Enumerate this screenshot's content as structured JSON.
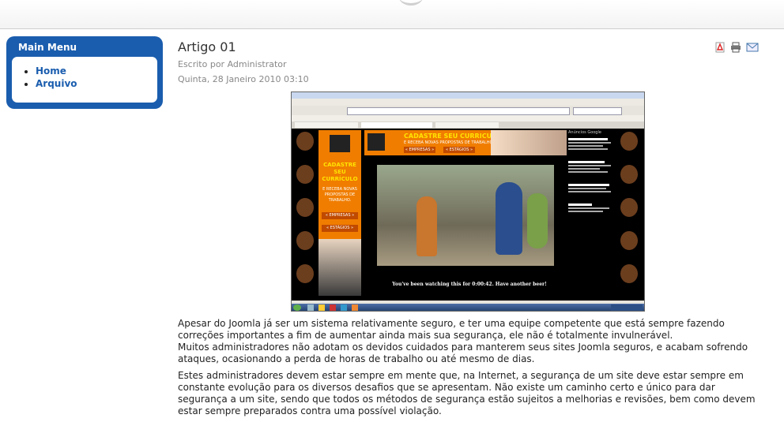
{
  "sidebar": {
    "title": "Main Menu",
    "items": [
      {
        "label": "Home"
      },
      {
        "label": "Arquivo"
      }
    ]
  },
  "article": {
    "title": "Artigo 01",
    "author": "Escrito por Administrator",
    "date": "Quinta, 28 Janeiro 2010 03:10",
    "paragraph1_line1": "Apesar do Joomla já ser um sistema relativamente seguro, e ter uma equipe competente que está sempre fazendo correções importantes a fim de aumentar ainda mais sua segurança, ele não é totalmente invulnerável.",
    "paragraph1_line2": "Muitos administradores não adotam os devidos cuidados para manterem seus sites Joomla seguros, e acabam sofrendo ataques, ocasionando a perda de horas de trabalho ou até mesmo de dias.",
    "paragraph2": "Estes administradores devem estar sempre em mente que, na Internet, a segurança de um site deve estar sempre em constante evolução para os diversos desafios que se apresentam. Não existe um caminho certo e único para dar segurança a um site, sendo que todos os métodos de segurança estão sujeitos a melhorias e revisões, bem como devem estar sempre preparados contra uma possível violação."
  },
  "screenshot": {
    "banner_main": "CADASTRE SEU CURRICULO",
    "banner_sub": "E RECEBA NOVAS PROPOSTAS DE TRABALHO.",
    "side_title": "CADASTRE SEU CURRÍCULO",
    "side_sub": "E RECEBA NOVAS PROPOSTAS DE TRABALHO.",
    "btn_empresas": "« EMPRESAS »",
    "btn_estagios": "« ESTÁGIOS »",
    "video_caption": "You've been watching this for 0:00:42. Have another beer!",
    "google_ads": "Anúncios Google"
  },
  "colors": {
    "menu_blue": "#1a5dae",
    "banner_orange": "#f07d00"
  }
}
